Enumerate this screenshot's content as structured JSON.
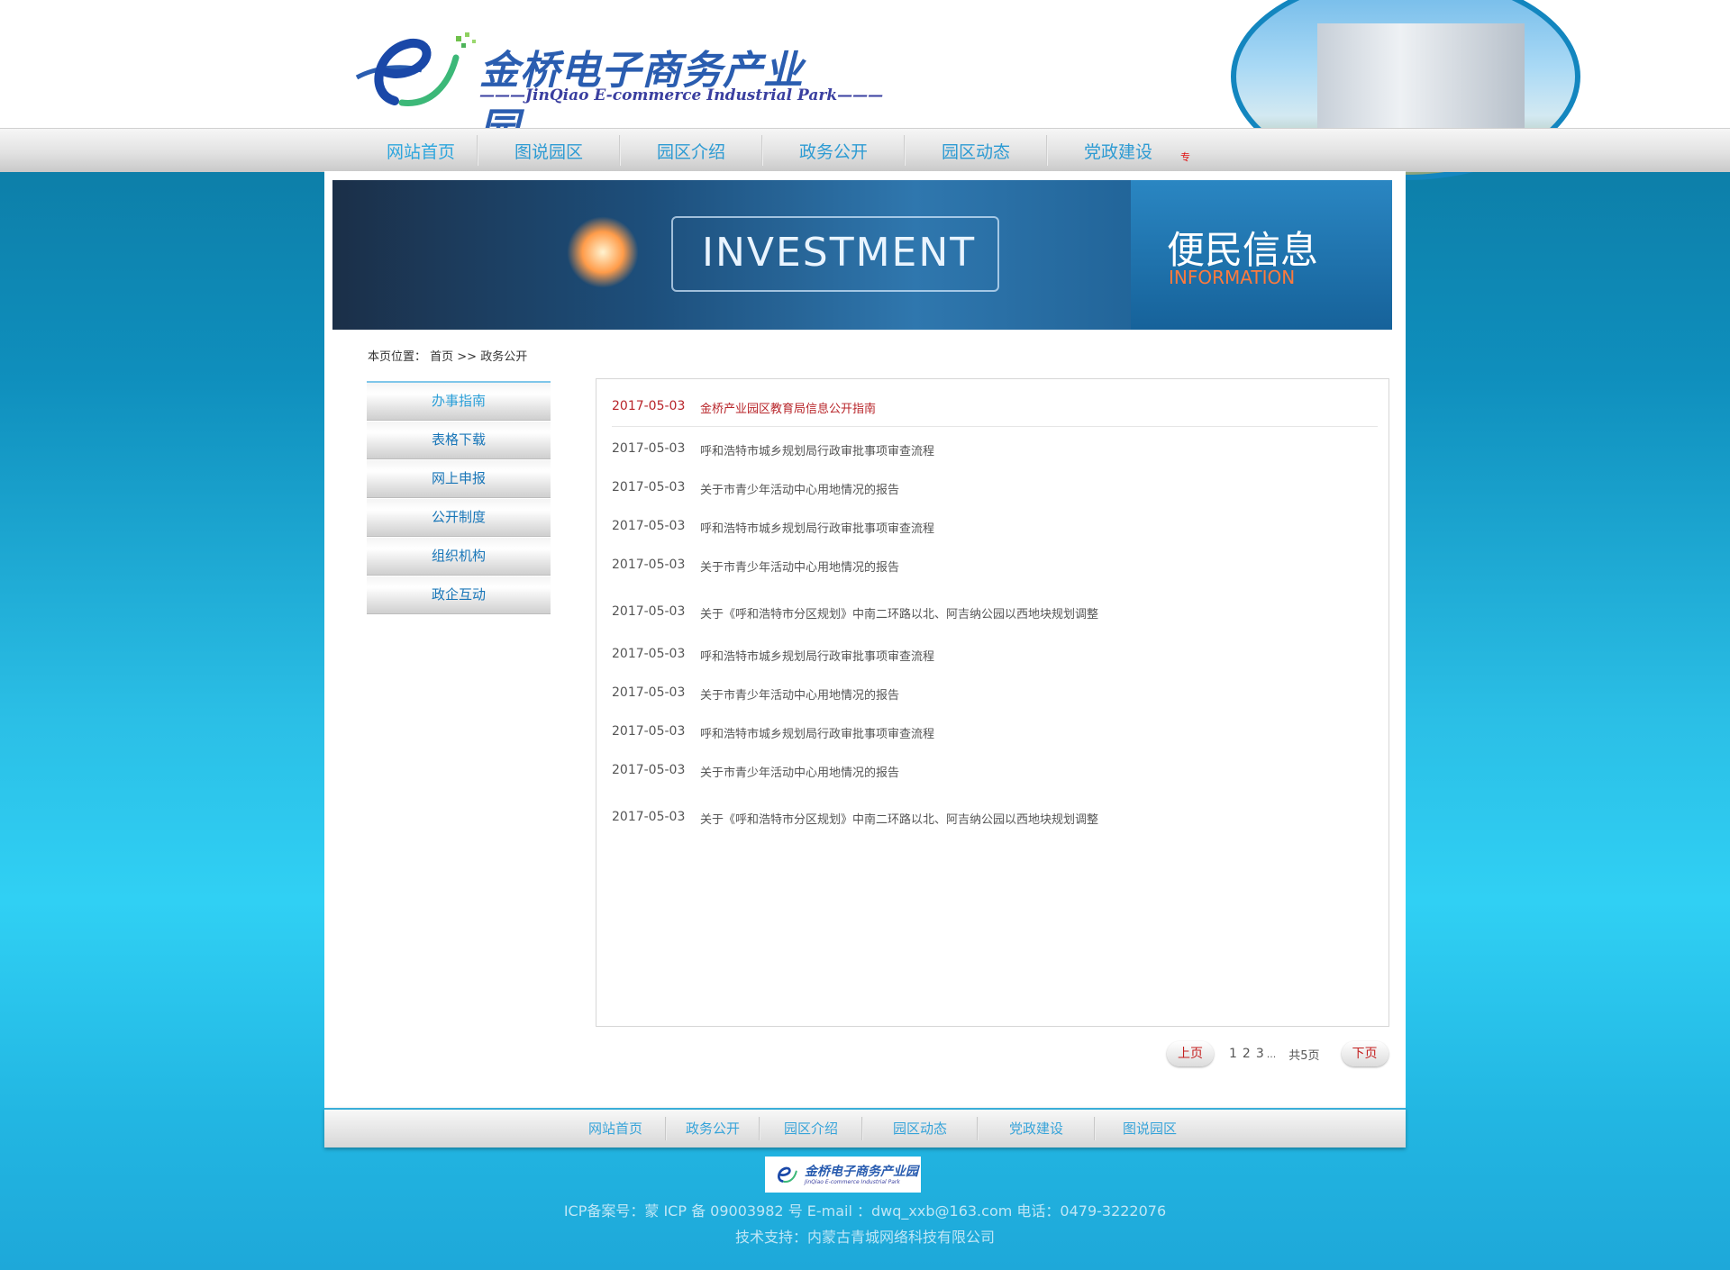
{
  "logo": {
    "title_cn": "金桥电子商务产业园",
    "title_en": "———JinQiao E-commerce Industrial Park———"
  },
  "nav": {
    "items": [
      {
        "label": "网站首页"
      },
      {
        "label": "图说园区"
      },
      {
        "label": "园区介绍"
      },
      {
        "label": "政务公开"
      },
      {
        "label": "园区动态"
      },
      {
        "label": "党政建设"
      }
    ],
    "hot_badge": "专"
  },
  "banner": {
    "invest_text": "INVESTMENT",
    "title_cn": "便民信息",
    "title_en": "INFORMATION"
  },
  "breadcrumb": {
    "label": "本页位置：",
    "path": "首页 >> 政务公开"
  },
  "sidebar": {
    "items": [
      {
        "label": "办事指南"
      },
      {
        "label": "表格下载"
      },
      {
        "label": "网上申报"
      },
      {
        "label": "公开制度"
      },
      {
        "label": "组织机构"
      },
      {
        "label": "政企互动"
      }
    ]
  },
  "list": {
    "rows": [
      {
        "date": "2017-05-03",
        "title": "金桥产业园区教育局信息公开指南"
      },
      {
        "date": "2017-05-03",
        "title": "呼和浩特市城乡规划局行政审批事项审查流程"
      },
      {
        "date": "2017-05-03",
        "title": "关于市青少年活动中心用地情况的报告"
      },
      {
        "date": "2017-05-03",
        "title": "呼和浩特市城乡规划局行政审批事项审查流程"
      },
      {
        "date": "2017-05-03",
        "title": "关于市青少年活动中心用地情况的报告"
      },
      {
        "date": "2017-05-03",
        "title": "关于《呼和浩特市分区规划》中南二环路以北、阿吉纳公园以西地块规划调整"
      },
      {
        "date": "2017-05-03",
        "title": "呼和浩特市城乡规划局行政审批事项审查流程"
      },
      {
        "date": "2017-05-03",
        "title": "关于市青少年活动中心用地情况的报告"
      },
      {
        "date": "2017-05-03",
        "title": "呼和浩特市城乡规划局行政审批事项审查流程"
      },
      {
        "date": "2017-05-03",
        "title": "关于市青少年活动中心用地情况的报告"
      },
      {
        "date": "2017-05-03",
        "title": "关于《呼和浩特市分区规划》中南二环路以北、阿吉纳公园以西地块规划调整"
      }
    ]
  },
  "pager": {
    "prev": "上页",
    "pages": [
      "1",
      "2",
      "3"
    ],
    "ellipsis": "...",
    "total": "共5页",
    "next": "下页"
  },
  "footer": {
    "nav": [
      {
        "label": "网站首页"
      },
      {
        "label": "政务公开"
      },
      {
        "label": "园区介绍"
      },
      {
        "label": "园区动态"
      },
      {
        "label": "党政建设"
      },
      {
        "label": "图说园区"
      }
    ],
    "logo_cn": "金桥电子商务产业园",
    "logo_en": "JinQiao E-commerce Industrial Park",
    "icp": "ICP备案号：蒙 ICP 备 09003982 号 E-mail ：dwq_xxb@163.com 电话：0479-3222076",
    "support": "技术支持：内蒙古青城网络科技有限公司"
  }
}
